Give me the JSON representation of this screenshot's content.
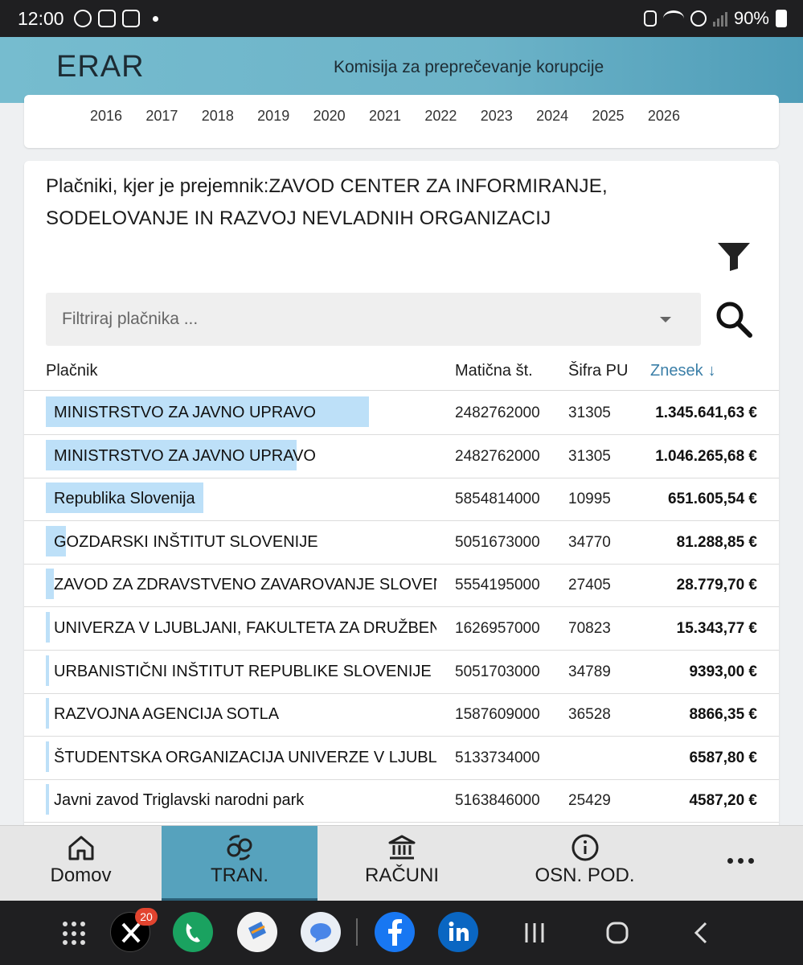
{
  "status_bar": {
    "time": "12:00",
    "battery": "90%"
  },
  "header": {
    "logo": "ERAR",
    "subtitle": "Komisija za preprečevanje korupcije"
  },
  "years": [
    "2016",
    "2017",
    "2018",
    "2019",
    "2020",
    "2021",
    "2022",
    "2023",
    "2024",
    "2025",
    "2026"
  ],
  "card": {
    "title_label": "Plačniki, kjer je prejemnik:",
    "title_name": "ZAVOD CENTER ZA INFORMIRANJE, SODELOVANJE IN RAZVOJ NEVLADNIH ORGANIZACIJ"
  },
  "filter": {
    "placeholder": "Filtriraj plačnika ..."
  },
  "table": {
    "columns": {
      "payer": "Plačnik",
      "mat": "Matična št.",
      "sifra": "Šifra PU",
      "amount": "Znesek"
    },
    "rows": [
      {
        "payer": "MINISTRSTVO ZA JAVNO UPRAVO",
        "mat": "2482762000",
        "sifra": "31305",
        "amount": "1.345.641,63 €",
        "share": 0.8
      },
      {
        "payer": "MINISTRSTVO ZA JAVNO UPRAVO",
        "mat": "2482762000",
        "sifra": "31305",
        "amount": "1.046.265,68 €",
        "share": 0.62
      },
      {
        "payer": "Republika Slovenija",
        "mat": "5854814000",
        "sifra": "10995",
        "amount": "651.605,54 €",
        "share": 0.39
      },
      {
        "payer": "GOZDARSKI INŠTITUT SLOVENIJE",
        "mat": "5051673000",
        "sifra": "34770",
        "amount": "81.288,85 €",
        "share": 0.05
      },
      {
        "payer": "ZAVOD ZA ZDRAVSTVENO ZAVAROVANJE SLOVENIJ",
        "mat": "5554195000",
        "sifra": "27405",
        "amount": "28.779,70 €",
        "share": 0.02
      },
      {
        "payer": "UNIVERZA V LJUBLJANI, FAKULTETA ZA DRUŽBENI",
        "mat": "1626957000",
        "sifra": "70823",
        "amount": "15.343,77 €",
        "share": 0.01
      },
      {
        "payer": "URBANISTIČNI INŠTITUT REPUBLIKE SLOVENIJE",
        "mat": "5051703000",
        "sifra": "34789",
        "amount": "9393,00 €",
        "share": 0.006
      },
      {
        "payer": "RAZVOJNA AGENCIJA SOTLA",
        "mat": "1587609000",
        "sifra": "36528",
        "amount": "8866,35 €",
        "share": 0.006
      },
      {
        "payer": "ŠTUDENTSKA ORGANIZACIJA UNIVERZE V LJUBLJA",
        "mat": "5133734000",
        "sifra": "",
        "amount": "6587,80 €",
        "share": 0.005
      },
      {
        "payer": "Javni zavod Triglavski narodni park",
        "mat": "5163846000",
        "sifra": "25429",
        "amount": "4587,20 €",
        "share": 0.003
      }
    ]
  },
  "nav": {
    "home": "Domov",
    "tran": "TRAN.",
    "racuni": "RAČUNI",
    "osn": "OSN. POD."
  },
  "dock": {
    "x_badge": "20"
  },
  "colors": {
    "header": "#6cb3c8",
    "active_tab": "#56a2bd",
    "bar": "#bde0f8",
    "sort_link": "#3b7fa8"
  }
}
